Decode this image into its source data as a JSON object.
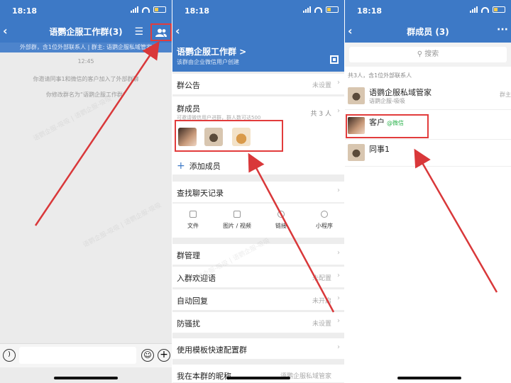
{
  "colors": {
    "brand_blue": "#3d79c6",
    "highlight_red": "#e23c3c",
    "wechat_green": "#2bb24c",
    "arrow_red": "#d9383a"
  },
  "status_bar": {
    "time": "18:18"
  },
  "chat": {
    "title": "语鹦企服工作群(3)",
    "notice": "外部群，含1位外部联系人 | 群主: 语鹦企服私域管家",
    "time": "12:45",
    "messages": [
      "你邀请同事1和微信的客户加入了外部群聊",
      "你修改群名为“语鹦企服工作群”"
    ],
    "icons": [
      "back-icon",
      "menu-icon",
      "group-members-icon",
      "voice-icon",
      "emoji-icon",
      "plus-icon"
    ]
  },
  "settings": {
    "group_name": "语鹦企服工作群 >",
    "group_sub": "该群由企业微信用户创建",
    "announcement": {
      "label": "群公告",
      "value": "未设置"
    },
    "members": {
      "label": "群成员",
      "hint": "可邀请微信用户进群，群人数可达500",
      "value": "共 3 人"
    },
    "add_member": "添加成员",
    "search_history": "查找聊天记录",
    "tools": [
      "文件",
      "图片 / 视频",
      "链接",
      "小程序"
    ],
    "rows": [
      {
        "label": "群管理",
        "value": ""
      },
      {
        "label": "入群欢迎语",
        "value": "未配置"
      },
      {
        "label": "自动回复",
        "value": "未开启"
      },
      {
        "label": "防骚扰",
        "value": "未设置"
      }
    ],
    "template_row": "使用模板快速配置群",
    "nickname": {
      "label": "我在本群的昵称",
      "value": "语鹦企服私域管家"
    }
  },
  "member_list": {
    "title": "群成员 (3)",
    "search_placeholder": "搜索",
    "count_text": "共3人，含1位外部联系人",
    "members": [
      {
        "name": "语鹦企服私域管家",
        "sub": "语鹦企服-吸吸",
        "role": "群主",
        "tag": ""
      },
      {
        "name": "客户",
        "sub": "",
        "role": "",
        "tag": "@微信"
      },
      {
        "name": "同事1",
        "sub": "",
        "role": "",
        "tag": ""
      }
    ]
  }
}
